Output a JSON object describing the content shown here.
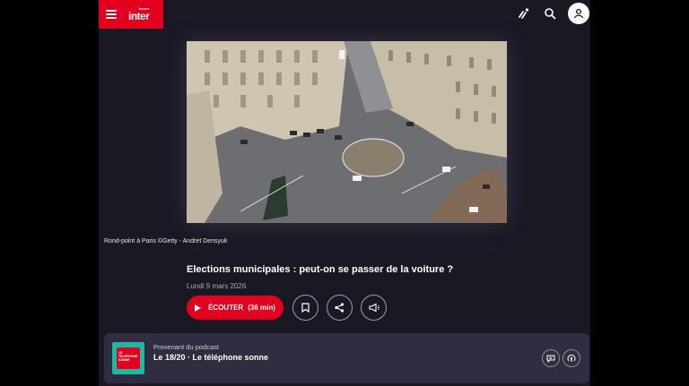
{
  "header": {
    "brand_small": "france",
    "brand_name": "inter",
    "icons": [
      "menu-icon",
      "live-radio-icon",
      "search-icon",
      "user-icon"
    ]
  },
  "hero": {
    "caption": "Rond-point à Paris ©Getty - Andret Densyuk"
  },
  "episode": {
    "title": "Elections municipales : peut-on se passer de la voiture ?",
    "date": "Lundi 9 mars 2026",
    "listen_label": "ÉCOUTER",
    "duration": "(36 min)",
    "actions": [
      "bookmark-icon",
      "share-icon",
      "megaphone-icon"
    ]
  },
  "podcast": {
    "from_label": "Provenant du podcast",
    "title": "Le 18/20 · Le téléphone sonne",
    "cover_text": "LE TÉLÉPHONE SONNE",
    "actions": [
      "chat-icon",
      "podcast-icon"
    ]
  },
  "colors": {
    "brand_red": "#e1001e",
    "background": "#1a1823",
    "card": "#302d40",
    "cover_teal": "#1fb8a3"
  }
}
